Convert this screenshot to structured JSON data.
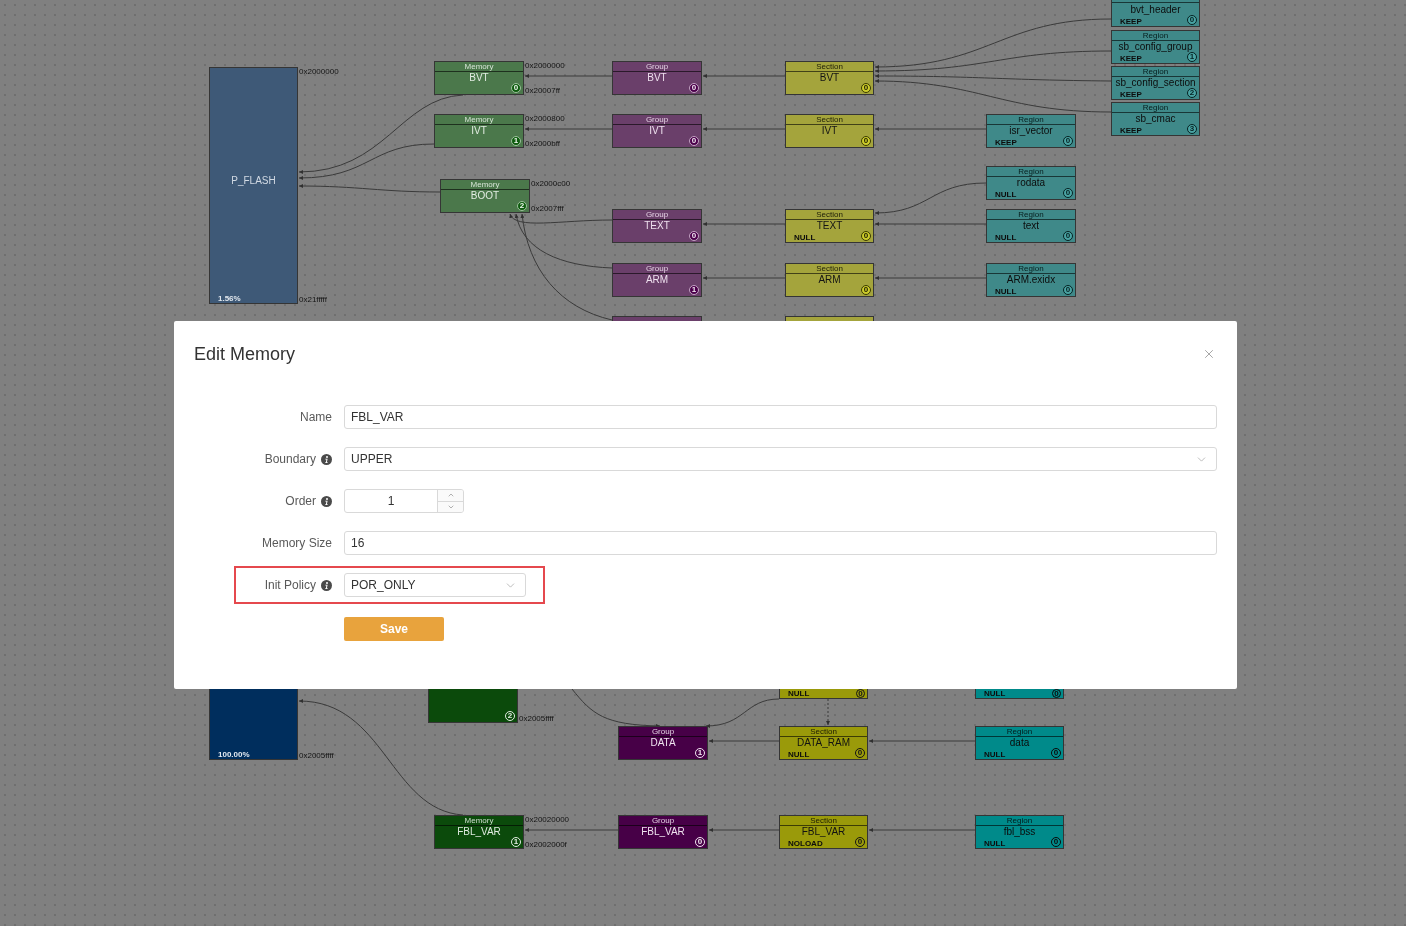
{
  "diagram": {
    "nodes": [
      {
        "kind": "device",
        "name": "P_FLASH",
        "usage": "1.56%",
        "start": "0x2000000",
        "end": "0x21fffff",
        "faded": true
      },
      {
        "kind": "memory",
        "header": "Memory",
        "name": "BVT",
        "badge": "0",
        "start": "0x2000000",
        "end": "0x20007ff",
        "faded": true
      },
      {
        "kind": "memory",
        "header": "Memory",
        "name": "IVT",
        "badge": "1",
        "start": "0x2000800",
        "end": "0x2000bff",
        "faded": true
      },
      {
        "kind": "memory",
        "header": "Memory",
        "name": "BOOT",
        "badge": "2",
        "start": "0x2000c00",
        "end": "0x2007fff",
        "faded": true
      },
      {
        "kind": "group",
        "header": "Group",
        "name": "BVT",
        "badge": "0",
        "faded": true
      },
      {
        "kind": "group",
        "header": "Group",
        "name": "IVT",
        "badge": "0",
        "faded": true
      },
      {
        "kind": "group",
        "header": "Group",
        "name": "TEXT",
        "badge": "0",
        "faded": true
      },
      {
        "kind": "group",
        "header": "Group",
        "name": "ARM",
        "badge": "1",
        "faded": true
      },
      {
        "kind": "group",
        "faded": true
      },
      {
        "kind": "section",
        "header": "Section",
        "name": "BVT",
        "badge": "0",
        "faded": true
      },
      {
        "kind": "section",
        "header": "Section",
        "name": "IVT",
        "badge": "0",
        "faded": true
      },
      {
        "kind": "section",
        "header": "Section",
        "name": "TEXT",
        "flag": "NULL",
        "badge": "0",
        "faded": true
      },
      {
        "kind": "section",
        "header": "Section",
        "name": "ARM",
        "badge": "0",
        "faded": true
      },
      {
        "kind": "section",
        "faded": true
      },
      {
        "kind": "region",
        "name": "bvt_header",
        "flag": "KEEP",
        "badge": "0",
        "faded": true
      },
      {
        "kind": "region",
        "header": "Region",
        "name": "sb_config_group",
        "flag": "KEEP",
        "badge": "1",
        "faded": true
      },
      {
        "kind": "region",
        "header": "Region",
        "name": "sb_config_section",
        "flag": "KEEP",
        "badge": "2",
        "faded": true
      },
      {
        "kind": "region",
        "header": "Region",
        "name": "sb_cmac",
        "flag": "KEEP",
        "badge": "3",
        "faded": true
      },
      {
        "kind": "region",
        "header": "Region",
        "name": "isr_vector",
        "flag": "KEEP",
        "badge": "0",
        "faded": true
      },
      {
        "kind": "region",
        "header": "Region",
        "name": "rodata",
        "flag": "NULL",
        "badge": "0",
        "faded": true
      },
      {
        "kind": "region",
        "header": "Region",
        "name": "text",
        "flag": "NULL",
        "badge": "0",
        "faded": true
      },
      {
        "kind": "region",
        "header": "Region",
        "name": "ARM.exidx",
        "flag": "NULL",
        "badge": "0",
        "faded": true
      },
      {
        "kind": "device",
        "usage": "100.00%",
        "end": "0x2005ffff",
        "faded": false
      },
      {
        "kind": "memory",
        "badge": "2",
        "end": "0x2005ffff",
        "faded": false
      },
      {
        "kind": "section",
        "flag": "NULL",
        "badge": "0",
        "faded": false
      },
      {
        "kind": "region",
        "flag": "NULL",
        "badge": "0",
        "faded": false
      },
      {
        "kind": "group",
        "header": "Group",
        "name": "DATA",
        "badge": "1",
        "faded": false
      },
      {
        "kind": "section",
        "header": "Section",
        "name": "DATA_RAM",
        "flag": "NULL",
        "badge": "0",
        "faded": false
      },
      {
        "kind": "region",
        "header": "Region",
        "name": "data",
        "flag": "NULL",
        "badge": "0",
        "faded": false
      },
      {
        "kind": "memory",
        "header": "Memory",
        "name": "FBL_VAR",
        "badge": "1",
        "start": "0x20020000",
        "end": "0x2002000f",
        "faded": false
      },
      {
        "kind": "group",
        "header": "Group",
        "name": "FBL_VAR",
        "badge": "0",
        "faded": false
      },
      {
        "kind": "section",
        "header": "Section",
        "name": "FBL_VAR",
        "flag": "NOLOAD",
        "badge": "0",
        "faded": false
      },
      {
        "kind": "region",
        "header": "Region",
        "name": "fbl_bss",
        "flag": "NULL",
        "badge": "0",
        "faded": false
      }
    ]
  },
  "dialog": {
    "title": "Edit Memory",
    "fields": [
      {
        "kind": "text",
        "label": "Name",
        "info": false,
        "value": "FBL_VAR",
        "highlighted": false
      },
      {
        "kind": "select",
        "label": "Boundary",
        "info": true,
        "value": "UPPER",
        "highlighted": false
      },
      {
        "kind": "number",
        "label": "Order",
        "info": true,
        "value": "1",
        "highlighted": false
      },
      {
        "kind": "text",
        "label": "Memory Size",
        "info": false,
        "value": "16",
        "highlighted": false
      },
      {
        "kind": "select",
        "label": "Init Policy",
        "info": true,
        "value": "POR_ONLY",
        "highlighted": true
      }
    ],
    "save_button": "Save"
  }
}
